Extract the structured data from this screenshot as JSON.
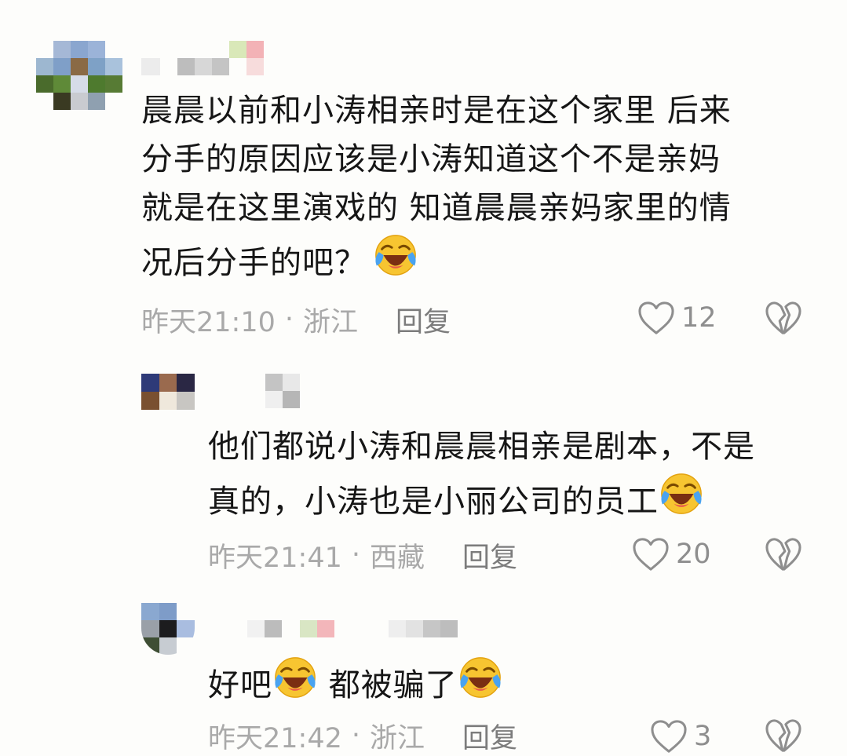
{
  "comments": [
    {
      "text_lines": [
        "晨晨以前和小涛相亲时是在这个家里 后来",
        "分手的原因应该是小涛知道这个不是亲妈",
        "就是在这里演戏的 知道晨晨亲妈家里的情",
        "况后分手的吧？"
      ],
      "time": "昨天21:10",
      "location": "浙江",
      "reply_label": "回复",
      "likes": "12"
    },
    {
      "text_lines": [
        "他们都说小涛和晨晨相亲是剧本，不是",
        "真的，小涛也是小丽公司的员工"
      ],
      "time": "昨天21:41",
      "location": "西藏",
      "reply_label": "回复",
      "likes": "20"
    },
    {
      "text_part1": "好吧",
      "text_part2": "都被骗了",
      "time": "昨天21:42",
      "location": "浙江",
      "reply_label": "回复",
      "likes": "3"
    }
  ],
  "separator": "·",
  "icons": {
    "like": "heart-outline-icon",
    "dislike": "broken-heart-icon",
    "emoji": "rofl-laugh-cry-emoji"
  },
  "colors": {
    "background": "#fdfdfb",
    "text": "#161616",
    "meta": "#a9a9a9",
    "reply": "#7c7c7c",
    "icon": "#8e8e8e"
  }
}
